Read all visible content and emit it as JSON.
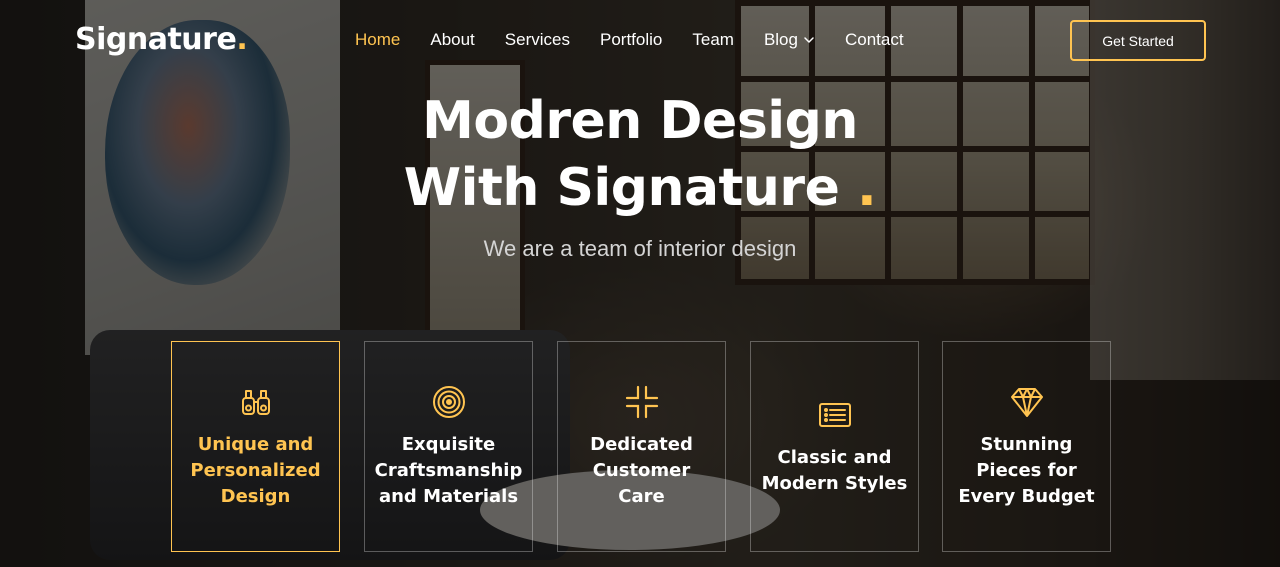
{
  "brand": {
    "name": "Signature",
    "dot": ".",
    "accent": "#ffc451"
  },
  "nav": {
    "items": [
      {
        "label": "Home",
        "active": true
      },
      {
        "label": "About"
      },
      {
        "label": "Services"
      },
      {
        "label": "Portfolio"
      },
      {
        "label": "Team"
      },
      {
        "label": "Blog",
        "has_dropdown": true
      },
      {
        "label": "Contact"
      }
    ],
    "cta_label": "Get Started"
  },
  "hero": {
    "title_line1": "Modren Design",
    "title_line2": "With Signature",
    "title_dot": ".",
    "subtitle": "We are a team of interior design"
  },
  "features": [
    {
      "label": "Unique and Personalized Design",
      "icon": "binoculars-icon",
      "active": true
    },
    {
      "label": "Exquisite Craftsmanship and Materials",
      "icon": "target-icon"
    },
    {
      "label": "Dedicated Customer Care",
      "icon": "shrink-icon"
    },
    {
      "label": "Classic and Modern Styles",
      "icon": "list-card-icon"
    },
    {
      "label": "Stunning Pieces for Every Budget",
      "icon": "gem-icon"
    }
  ]
}
